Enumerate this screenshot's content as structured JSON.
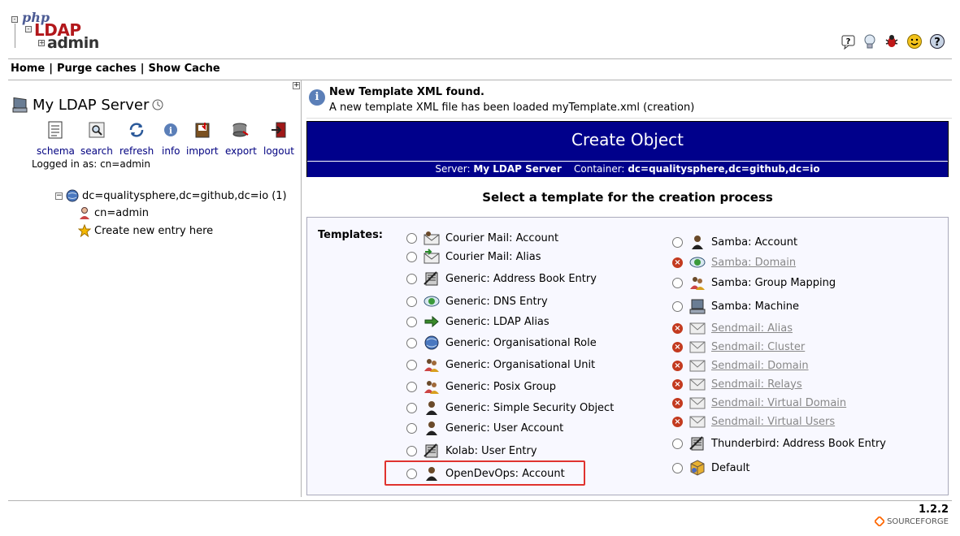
{
  "logo": {
    "php": "php",
    "ldap": "LDAP",
    "admin": "admin"
  },
  "top_icons": [
    "help-bubble-icon",
    "lightbulb-icon",
    "bug-icon",
    "smiley-icon",
    "question-icon"
  ],
  "menu": {
    "home": "Home",
    "purge": "Purge caches",
    "show_cache": "Show Cache",
    "sep": "|"
  },
  "server": {
    "name": "My LDAP Server",
    "tools": [
      {
        "label": "schema",
        "icon": "schema-icon"
      },
      {
        "label": "search",
        "icon": "search-icon"
      },
      {
        "label": "refresh",
        "icon": "refresh-icon"
      },
      {
        "label": "info",
        "icon": "info-icon"
      },
      {
        "label": "import",
        "icon": "import-icon"
      },
      {
        "label": "export",
        "icon": "export-icon"
      },
      {
        "label": "logout",
        "icon": "logout-icon"
      }
    ],
    "logged_in": "Logged in as: cn=admin"
  },
  "tree": {
    "base_dn": "dc=qualitysphere,dc=github,dc=io",
    "count": "(1)",
    "child": "cn=admin",
    "create": "Create new entry here"
  },
  "notice": {
    "title": "New Template XML found.",
    "text": "A new template XML file has been loaded myTemplate.xml (creation)"
  },
  "banner": {
    "title": "Create Object",
    "server_label": "Server:",
    "server_value": "My LDAP Server",
    "container_label": "Container:",
    "container_value": "dc=qualitysphere,dc=github,dc=io"
  },
  "select_title": "Select a template for the creation process",
  "templates_label": "Templates:",
  "templates_left": [
    {
      "label": "Courier Mail: Account",
      "icon": "mail-account-icon"
    },
    {
      "label": "Courier Mail: Alias",
      "icon": "mail-alias-icon"
    },
    {
      "label": "Generic: Address Book Entry",
      "icon": "address-book-icon"
    },
    {
      "label": "Generic: DNS Entry",
      "icon": "dns-icon"
    },
    {
      "label": "Generic: LDAP Alias",
      "icon": "alias-arrow-icon"
    },
    {
      "label": "Generic: Organisational Role",
      "icon": "globe-icon"
    },
    {
      "label": "Generic: Organisational Unit",
      "icon": "group-icon"
    },
    {
      "label": "Generic: Posix Group",
      "icon": "group-icon"
    },
    {
      "label": "Generic: Simple Security Object",
      "icon": "user-icon"
    },
    {
      "label": "Generic: User Account",
      "icon": "user-icon"
    },
    {
      "label": "Kolab: User Entry",
      "icon": "address-book-icon"
    },
    {
      "label": "OpenDevOps: Account",
      "icon": "user-icon"
    }
  ],
  "templates_right": [
    {
      "label": "Samba: Account",
      "icon": "user-icon",
      "disabled": false
    },
    {
      "label": "Samba: Domain",
      "icon": "dns-icon",
      "disabled": true
    },
    {
      "label": "Samba: Group Mapping",
      "icon": "group-icon",
      "disabled": false
    },
    {
      "label": "Samba: Machine",
      "icon": "computer-icon",
      "disabled": false
    },
    {
      "label": "Sendmail: Alias",
      "icon": "envelope-icon",
      "disabled": true
    },
    {
      "label": "Sendmail: Cluster",
      "icon": "envelope-icon",
      "disabled": true
    },
    {
      "label": "Sendmail: Domain",
      "icon": "envelope-icon",
      "disabled": true
    },
    {
      "label": "Sendmail: Relays",
      "icon": "envelope-icon",
      "disabled": true
    },
    {
      "label": "Sendmail: Virtual Domain",
      "icon": "envelope-icon",
      "disabled": true
    },
    {
      "label": "Sendmail: Virtual Users",
      "icon": "envelope-icon",
      "disabled": true
    },
    {
      "label": "Thunderbird: Address Book Entry",
      "icon": "address-book-icon",
      "disabled": false
    },
    {
      "label": "Default",
      "icon": "object-icon",
      "disabled": false
    }
  ],
  "version": "1.2.2",
  "sourceforge": "SOURCEFORGE"
}
